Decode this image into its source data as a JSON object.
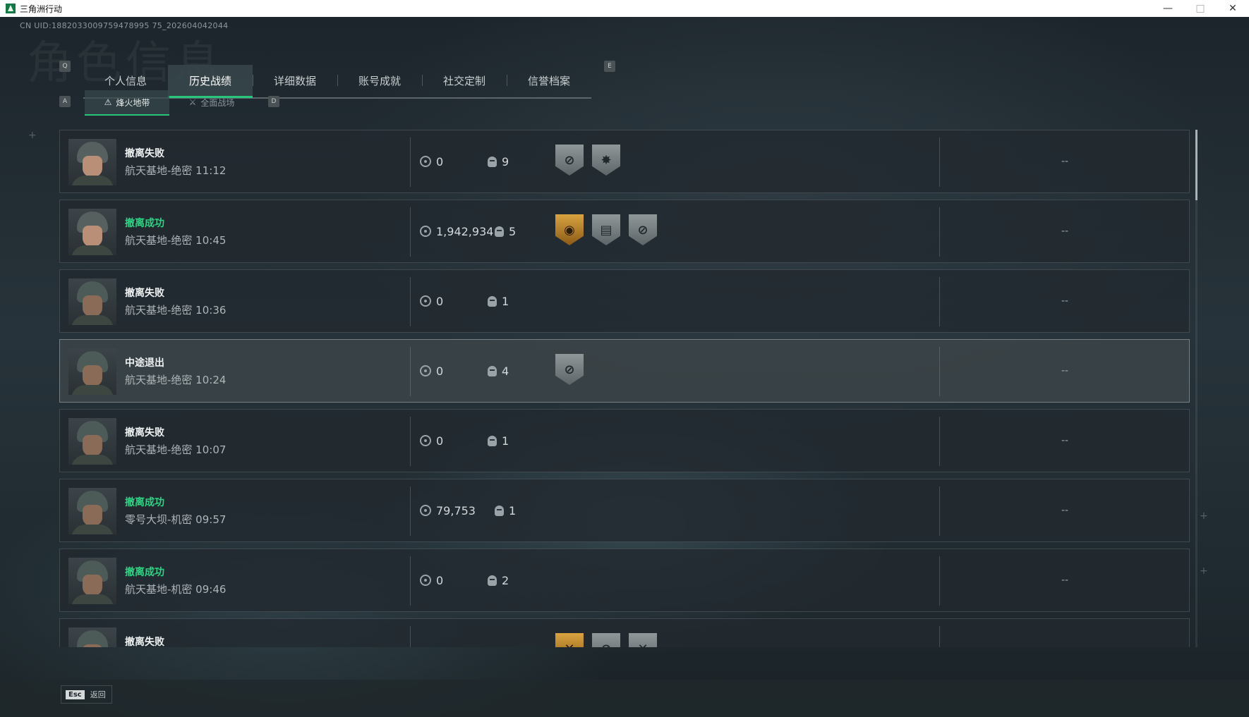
{
  "window": {
    "title": "三角洲行动",
    "controls": [
      "—",
      "□",
      "✕"
    ]
  },
  "uid": "CN UID:1882033009759478995 75_202604042044",
  "watermark": "角色信息",
  "keys": {
    "prev_tab": "Q",
    "next_tab": "E",
    "prev_sub": "A",
    "next_sub": "D"
  },
  "tabs": [
    {
      "label": "个人信息"
    },
    {
      "label": "历史战绩",
      "active": true
    },
    {
      "label": "详细数据"
    },
    {
      "label": "账号成就"
    },
    {
      "label": "社交定制"
    },
    {
      "label": "信誉档案"
    }
  ],
  "subtabs": [
    {
      "label": "烽火地带",
      "glyph": "⚠",
      "active": true
    },
    {
      "label": "全面战场",
      "glyph": "⚔"
    }
  ],
  "colors": {
    "accent": "#27c67a",
    "success": "#2bd683",
    "gold_badge": "#d9a340"
  },
  "records": [
    {
      "status": "撤离失败",
      "success": false,
      "map": "航天基地-绝密 11:12",
      "value": "0",
      "kills": "9",
      "badges": [
        "crosshair-badge",
        "explosion-badge"
      ],
      "extra": "--",
      "avatar": "female"
    },
    {
      "status": "撤离成功",
      "success": true,
      "map": "航天基地-绝密 10:45",
      "value": "1,942,934",
      "kills": "5",
      "badges": [
        "gold-coin-badge",
        "card-badge",
        "crosshair-badge"
      ],
      "extra": "--",
      "avatar": "female"
    },
    {
      "status": "撤离失败",
      "success": false,
      "map": "航天基地-绝密 10:36",
      "value": "0",
      "kills": "1",
      "badges": [],
      "extra": "--",
      "avatar": "male"
    },
    {
      "status": "中途退出",
      "success": false,
      "map": "航天基地-绝密 10:24",
      "value": "0",
      "kills": "4",
      "badges": [
        "crosshair-badge"
      ],
      "extra": "--",
      "avatar": "male",
      "highlight": true
    },
    {
      "status": "撤离失败",
      "success": false,
      "map": "航天基地-绝密 10:07",
      "value": "0",
      "kills": "1",
      "badges": [],
      "extra": "--",
      "avatar": "male"
    },
    {
      "status": "撤离成功",
      "success": true,
      "map": "零号大坝-机密 09:57",
      "value": "79,753",
      "kills": "1",
      "badges": [],
      "extra": "--",
      "avatar": "male"
    },
    {
      "status": "撤离成功",
      "success": true,
      "map": "航天基地-机密 09:46",
      "value": "0",
      "kills": "2",
      "badges": [],
      "extra": "--",
      "avatar": "male"
    },
    {
      "status": "撤离失败",
      "success": false,
      "map": "",
      "value": "",
      "kills": "",
      "badges": [
        "gold-wing-badge",
        "crosshair-badge",
        "wing-badge"
      ],
      "extra": "",
      "avatar": "male"
    }
  ],
  "footer": {
    "key": "Esc",
    "label": "返回"
  }
}
